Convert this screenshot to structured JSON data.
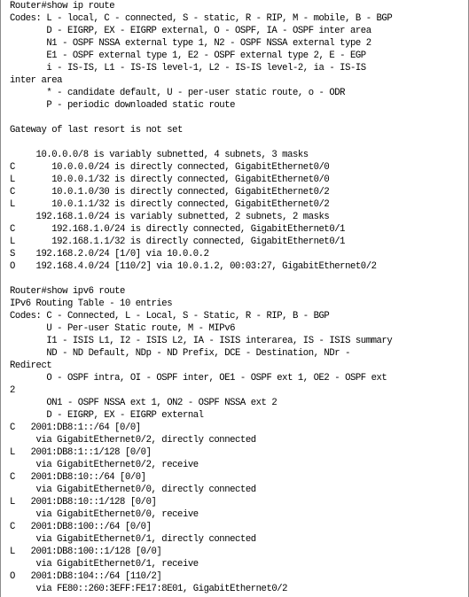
{
  "terminal": {
    "lines": [
      "Router#show ip route",
      "Codes: L - local, C - connected, S - static, R - RIP, M - mobile, B - BGP",
      "       D - EIGRP, EX - EIGRP external, O - OSPF, IA - OSPF inter area",
      "       N1 - OSPF NSSA external type 1, N2 - OSPF NSSA external type 2",
      "       E1 - OSPF external type 1, E2 - OSPF external type 2, E - EGP",
      "       i - IS-IS, L1 - IS-IS level-1, L2 - IS-IS level-2, ia - IS-IS",
      "inter area",
      "       * - candidate default, U - per-user static route, o - ODR",
      "       P - periodic downloaded static route",
      "",
      "Gateway of last resort is not set",
      "",
      "     10.0.0.0/8 is variably subnetted, 4 subnets, 3 masks",
      "C       10.0.0.0/24 is directly connected, GigabitEthernet0/0",
      "L       10.0.0.1/32 is directly connected, GigabitEthernet0/0",
      "C       10.0.1.0/30 is directly connected, GigabitEthernet0/2",
      "L       10.0.1.1/32 is directly connected, GigabitEthernet0/2",
      "     192.168.1.0/24 is variably subnetted, 2 subnets, 2 masks",
      "C       192.168.1.0/24 is directly connected, GigabitEthernet0/1",
      "L       192.168.1.1/32 is directly connected, GigabitEthernet0/1",
      "S    192.168.2.0/24 [1/0] via 10.0.0.2",
      "O    192.168.4.0/24 [110/2] via 10.0.1.2, 00:03:27, GigabitEthernet0/2",
      "",
      "Router#show ipv6 route",
      "IPv6 Routing Table - 10 entries",
      "Codes: C - Connected, L - Local, S - Static, R - RIP, B - BGP",
      "       U - Per-user Static route, M - MIPv6",
      "       I1 - ISIS L1, I2 - ISIS L2, IA - ISIS interarea, IS - ISIS summary",
      "       ND - ND Default, NDp - ND Prefix, DCE - Destination, NDr -",
      "Redirect",
      "       O - OSPF intra, OI - OSPF inter, OE1 - OSPF ext 1, OE2 - OSPF ext",
      "2",
      "       ON1 - OSPF NSSA ext 1, ON2 - OSPF NSSA ext 2",
      "       D - EIGRP, EX - EIGRP external",
      "C   2001:DB8:1::/64 [0/0]",
      "     via GigabitEthernet0/2, directly connected",
      "L   2001:DB8:1::1/128 [0/0]",
      "     via GigabitEthernet0/2, receive",
      "C   2001:DB8:10::/64 [0/0]",
      "     via GigabitEthernet0/0, directly connected",
      "L   2001:DB8:10::1/128 [0/0]",
      "     via GigabitEthernet0/0, receive",
      "C   2001:DB8:100::/64 [0/0]",
      "     via GigabitEthernet0/1, directly connected",
      "L   2001:DB8:100::1/128 [0/0]",
      "     via GigabitEthernet0/1, receive",
      "O   2001:DB8:104::/64 [110/2]",
      "     via FE80::260:3EFF:FE17:8E01, GigabitEthernet0/2"
    ]
  }
}
